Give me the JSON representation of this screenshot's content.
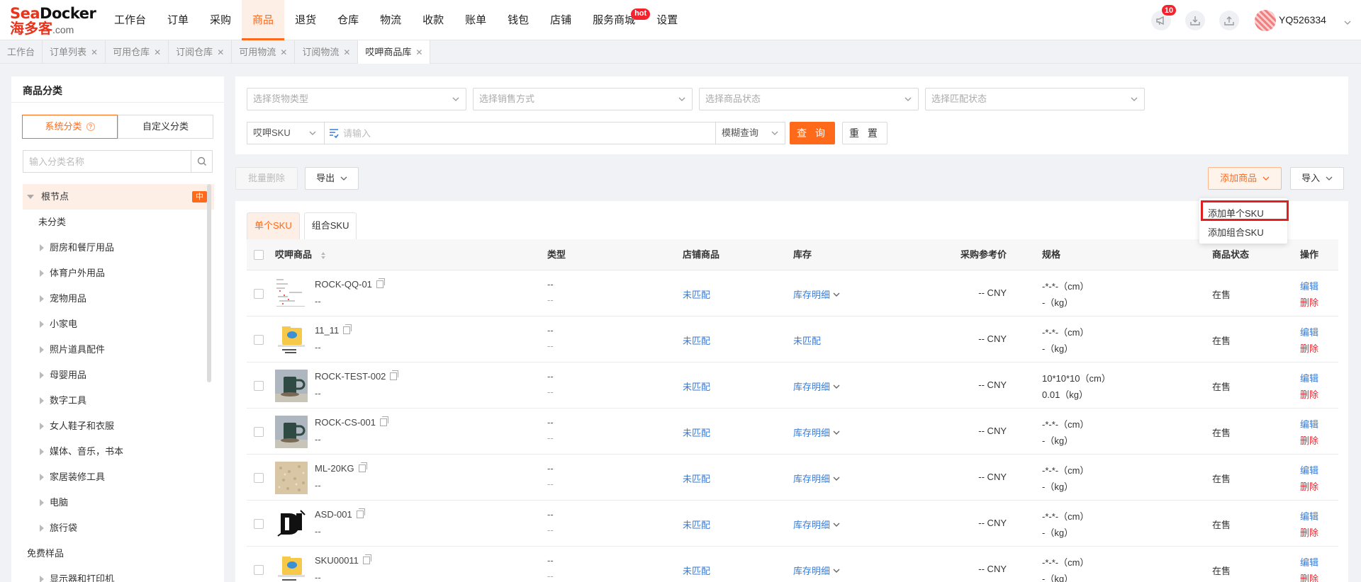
{
  "logo": {
    "brand": "SeaDocker",
    "brand_red": "Sea",
    "brand_dark": "Docker",
    "cn": "海多客",
    "domain": ".com"
  },
  "nav": [
    {
      "label": "工作台"
    },
    {
      "label": "订单"
    },
    {
      "label": "采购"
    },
    {
      "label": "商品",
      "active": true
    },
    {
      "label": "退货"
    },
    {
      "label": "仓库"
    },
    {
      "label": "物流"
    },
    {
      "label": "收款"
    },
    {
      "label": "账单"
    },
    {
      "label": "钱包"
    },
    {
      "label": "店铺"
    },
    {
      "label": "服务商城",
      "badge": "hot"
    },
    {
      "label": "设置"
    }
  ],
  "header": {
    "notification_count": "10",
    "username": "YQ526334",
    "icons": [
      "megaphone-icon",
      "download-icon",
      "upload-icon"
    ]
  },
  "page_tabs": [
    {
      "label": "工作台",
      "closable": false
    },
    {
      "label": "订单列表",
      "closable": true
    },
    {
      "label": "可用仓库",
      "closable": true
    },
    {
      "label": "订阅仓库",
      "closable": true
    },
    {
      "label": "可用物流",
      "closable": true
    },
    {
      "label": "订阅物流",
      "closable": true
    },
    {
      "label": "哎呷商品库",
      "closable": true,
      "active": true
    }
  ],
  "sidebar": {
    "title": "商品分类",
    "seg_system": "系统分类",
    "seg_custom": "自定义分类",
    "search_placeholder": "输入分类名称",
    "root": "根节点",
    "root_badge": "中",
    "items": [
      {
        "label": "未分类",
        "expandable": false
      },
      {
        "label": "厨房和餐厅用品",
        "expandable": true
      },
      {
        "label": "体育户外用品",
        "expandable": true
      },
      {
        "label": "宠物用品",
        "expandable": true
      },
      {
        "label": "小家电",
        "expandable": true
      },
      {
        "label": "照片道具配件",
        "expandable": true
      },
      {
        "label": "母婴用品",
        "expandable": true
      },
      {
        "label": "数字工具",
        "expandable": true
      },
      {
        "label": "女人鞋子和衣服",
        "expandable": true
      },
      {
        "label": "媒体、音乐，书本",
        "expandable": true
      },
      {
        "label": "家居装修工具",
        "expandable": true
      },
      {
        "label": "电脑",
        "expandable": true
      },
      {
        "label": "旅行袋",
        "expandable": true
      },
      {
        "label": "免费样品",
        "expandable": false
      },
      {
        "label": "显示器和打印机",
        "expandable": true
      }
    ]
  },
  "filters": {
    "goods_type": "选择货物类型",
    "sale_method": "选择销售方式",
    "product_status": "选择商品状态",
    "match_status": "选择匹配状态",
    "sku_type": "哎呷SKU",
    "sku_placeholder": "请输入",
    "match_mode": "模糊查询",
    "query": "查 询",
    "reset": "重 置"
  },
  "actions": {
    "batch_delete": "批量删除",
    "export": "导出",
    "add_product": "添加商品",
    "import": "导入"
  },
  "dropdown": {
    "items": [
      "添加单个SKU",
      "添加组合SKU"
    ]
  },
  "sub_tabs": [
    {
      "label": "单个SKU",
      "active": true
    },
    {
      "label": "组合SKU"
    }
  ],
  "table": {
    "columns": {
      "product": "哎呷商品",
      "type": "类型",
      "store": "店铺商品",
      "stock": "库存",
      "price": "采购参考价",
      "spec": "规格",
      "status": "商品状态",
      "ops": "操作"
    },
    "op_edit": "编辑",
    "op_delete": "删除",
    "rows": [
      {
        "sku": "ROCK-QQ-01",
        "sub": "--",
        "type1": "--",
        "type2": "--",
        "store": "未匹配",
        "stock": "库存明细",
        "stock_dropdown": true,
        "price": "-- CNY",
        "spec1": "-*-*-（cm）",
        "spec2": "-（kg）",
        "status": "在售",
        "thumb": "doc"
      },
      {
        "sku": "11_11",
        "sub": "--",
        "type1": "--",
        "type2": "--",
        "store": "未匹配",
        "stock": "未匹配",
        "stock_dropdown": false,
        "price": "-- CNY",
        "spec1": "-*-*-（cm）",
        "spec2": "-（kg）",
        "status": "在售",
        "thumb": "folder"
      },
      {
        "sku": "ROCK-TEST-002",
        "sub": "--",
        "type1": "--",
        "type2": "--",
        "store": "未匹配",
        "stock": "库存明细",
        "stock_dropdown": true,
        "price": "-- CNY",
        "spec1": "10*10*10（cm）",
        "spec2": "0.01（kg）",
        "status": "在售",
        "thumb": "mug"
      },
      {
        "sku": "ROCK-CS-001",
        "sub": "--",
        "type1": "--",
        "type2": "--",
        "store": "未匹配",
        "stock": "库存明细",
        "stock_dropdown": true,
        "price": "-- CNY",
        "spec1": "-*-*-（cm）",
        "spec2": "-（kg）",
        "status": "在售",
        "thumb": "mug"
      },
      {
        "sku": "ML-20KG",
        "sub": "--",
        "type1": "--",
        "type2": "--",
        "store": "未匹配",
        "stock": "库存明细",
        "stock_dropdown": true,
        "price": "-- CNY",
        "spec1": "-*-*-（cm）",
        "spec2": "-（kg）",
        "status": "在售",
        "thumb": "sand"
      },
      {
        "sku": "ASD-001",
        "sub": "--",
        "type1": "--",
        "type2": "--",
        "store": "未匹配",
        "stock": "库存明细",
        "stock_dropdown": true,
        "price": "-- CNY",
        "spec1": "-*-*-（cm）",
        "spec2": "-（kg）",
        "status": "在售",
        "thumb": "logo"
      },
      {
        "sku": "SKU00011",
        "sub": "--",
        "type1": "--",
        "type2": "--",
        "store": "未匹配",
        "stock": "库存明细",
        "stock_dropdown": true,
        "price": "-- CNY",
        "spec1": "-*-*-（cm）",
        "spec2": "-（kg）",
        "status": "在售",
        "thumb": "folder"
      }
    ]
  },
  "colors": {
    "accent": "#ff6a1a",
    "link": "#3a7bd5",
    "danger": "#f5222d",
    "highlight": "#e32020"
  }
}
